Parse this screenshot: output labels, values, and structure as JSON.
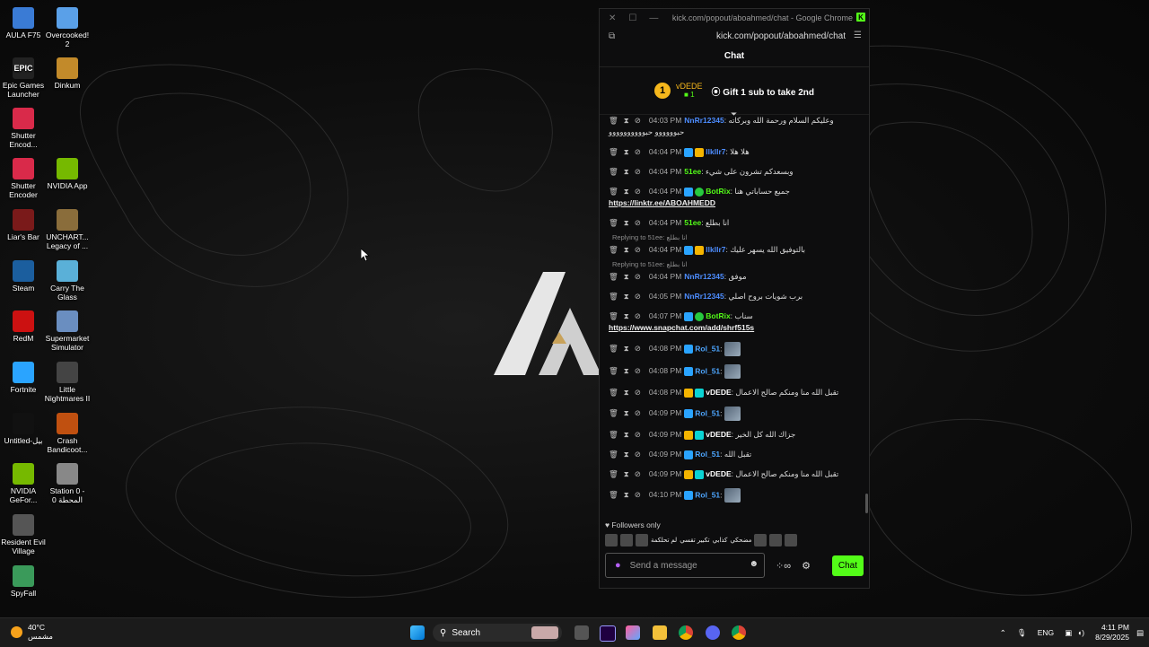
{
  "desktop": {
    "icons": [
      {
        "label": "AULA F75",
        "color": "#3a7bd5"
      },
      {
        "label": "Overcooked! 2",
        "color": "#5aa0e8"
      },
      {
        "label": "Epic Games Launcher",
        "color": "#222222",
        "glyph": "EPIC"
      },
      {
        "label": "Dinkum",
        "color": "#c28a2a"
      },
      {
        "label": "Shutter Encod...",
        "color": "#d92a4a"
      },
      {
        "label": "Shutter Encoder",
        "color": "#d92a4a"
      },
      {
        "label": "NVIDIA App",
        "color": "#76b900"
      },
      {
        "label": "Liar's Bar",
        "color": "#7a1a1a"
      },
      {
        "label": "UNCHART... Legacy of ...",
        "color": "#8a6d3b"
      },
      {
        "label": "Steam",
        "color": "#1b5e9e"
      },
      {
        "label": "Carry The Glass",
        "color": "#5ab0d8"
      },
      {
        "label": "RedM",
        "color": "#cc1111"
      },
      {
        "label": "Supermarket Simulator",
        "color": "#6a8ec0"
      },
      {
        "label": "Fortnite",
        "color": "#2aa4ff"
      },
      {
        "label": "Little Nightmares II",
        "color": "#444444"
      },
      {
        "label": "Untitled-بيل",
        "color": "#111111"
      },
      {
        "label": "Crash Bandicoot...",
        "color": "#c05010"
      },
      {
        "label": "NVIDIA GeFor...",
        "color": "#76b900"
      },
      {
        "label": "Station 0 - المحطة 0",
        "color": "#888888"
      },
      {
        "label": "Resident Evil Village",
        "color": "#555555"
      },
      {
        "label": "SpyFall",
        "color": "#3a9a5a"
      }
    ]
  },
  "browser": {
    "title": "kick.com/popout/aboahmed/chat - Google Chrome",
    "url": "kick.com/popout/aboahmed/chat"
  },
  "chat": {
    "header": "Chat",
    "top_gifter": {
      "rank": "1",
      "name": "vDEDE",
      "count": "1"
    },
    "gift_text": "Gift 1 sub to take 2nd",
    "messages": [
      {
        "time": "04:03 PM",
        "user": "NnRr12345",
        "color": "#4d8dff",
        "text": "وعليكم السلام ورحمة الله وبركاته حبوووووو حبوووووووووو",
        "badges": []
      },
      {
        "time": "04:04 PM",
        "user": "llkllr7",
        "color": "#4d8dff",
        "text": "هلا هلا",
        "badges": [
          "b-blue",
          "b-gold"
        ]
      },
      {
        "time": "04:04 PM",
        "user": "51ee",
        "color": "#53fc18",
        "text": "وبسعدكم تشرون على شيء",
        "badges": []
      },
      {
        "time": "04:04 PM",
        "user": "BotRix",
        "color": "#53fc18",
        "text": "جميع حساباتي هنا",
        "link": "https://linktr.ee/ABOAHMEDD",
        "badges": [
          "b-blue",
          "b-green"
        ]
      },
      {
        "time": "04:04 PM",
        "user": "51ee",
        "color": "#53fc18",
        "text": "انا بطلع",
        "badges": []
      },
      {
        "reply": "Replying to 51ee: انا بطلع",
        "time": "04:04 PM",
        "user": "llkllr7",
        "color": "#4d8dff",
        "text": "بالتوفيق الله يسهر عليك",
        "badges": [
          "b-blue",
          "b-gold"
        ]
      },
      {
        "reply": "Replying to 51ee: انا بطلع",
        "time": "04:04 PM",
        "user": "NnRr12345",
        "color": "#4d8dff",
        "text": "موفق",
        "badges": []
      },
      {
        "time": "04:05 PM",
        "user": "NnRr12345",
        "color": "#4d8dff",
        "text": "برب شويات بروح اصلي",
        "badges": []
      },
      {
        "time": "04:07 PM",
        "user": "BotRix",
        "color": "#53fc18",
        "text": "سناب",
        "link": "https://www.snapchat.com/add/shrf515s",
        "badges": [
          "b-blue",
          "b-green"
        ]
      },
      {
        "time": "04:08 PM",
        "user": "Rol_51",
        "color": "#4da6ff",
        "text": "",
        "emote": true,
        "badges": [
          "b-blue"
        ]
      },
      {
        "time": "04:08 PM",
        "user": "Rol_51",
        "color": "#4da6ff",
        "text": "",
        "emote": true,
        "badges": [
          "b-blue"
        ]
      },
      {
        "time": "04:08 PM",
        "user": "vDEDE",
        "color": "#ffffff",
        "text": "تقبل الله منا ومنكم صالح الاعمال",
        "badges": [
          "b-gold",
          "b-cyan"
        ]
      },
      {
        "time": "04:09 PM",
        "user": "Rol_51",
        "color": "#4da6ff",
        "text": "",
        "emote": true,
        "badges": [
          "b-blue"
        ]
      },
      {
        "time": "04:09 PM",
        "user": "vDEDE",
        "color": "#ffffff",
        "text": "جزاك الله كل الخير",
        "badges": [
          "b-gold",
          "b-cyan"
        ]
      },
      {
        "time": "04:09 PM",
        "user": "Rol_51",
        "color": "#4da6ff",
        "text": "تقبل الله",
        "badges": [
          "b-blue"
        ]
      },
      {
        "time": "04:09 PM",
        "user": "vDEDE",
        "color": "#ffffff",
        "text": "تقبل الله منا ومنكم صالح الاعمال",
        "badges": [
          "b-gold",
          "b-cyan"
        ]
      },
      {
        "time": "04:10 PM",
        "user": "Rol_51",
        "color": "#4da6ff",
        "text": "",
        "emote": true,
        "badges": [
          "b-blue"
        ]
      }
    ],
    "followers_only": "Followers only",
    "emote_labels": [
      "لم تحلكمة",
      "تكبير تقسي",
      "كذابي",
      "مضحكي"
    ],
    "input_placeholder": "Send a message",
    "chat_button": "Chat"
  },
  "taskbar": {
    "weather_temp": "40°C",
    "weather_desc": "مشمس",
    "search_label": "Search",
    "lang": "ENG",
    "time": "4:11 PM",
    "date": "8/29/2025"
  }
}
